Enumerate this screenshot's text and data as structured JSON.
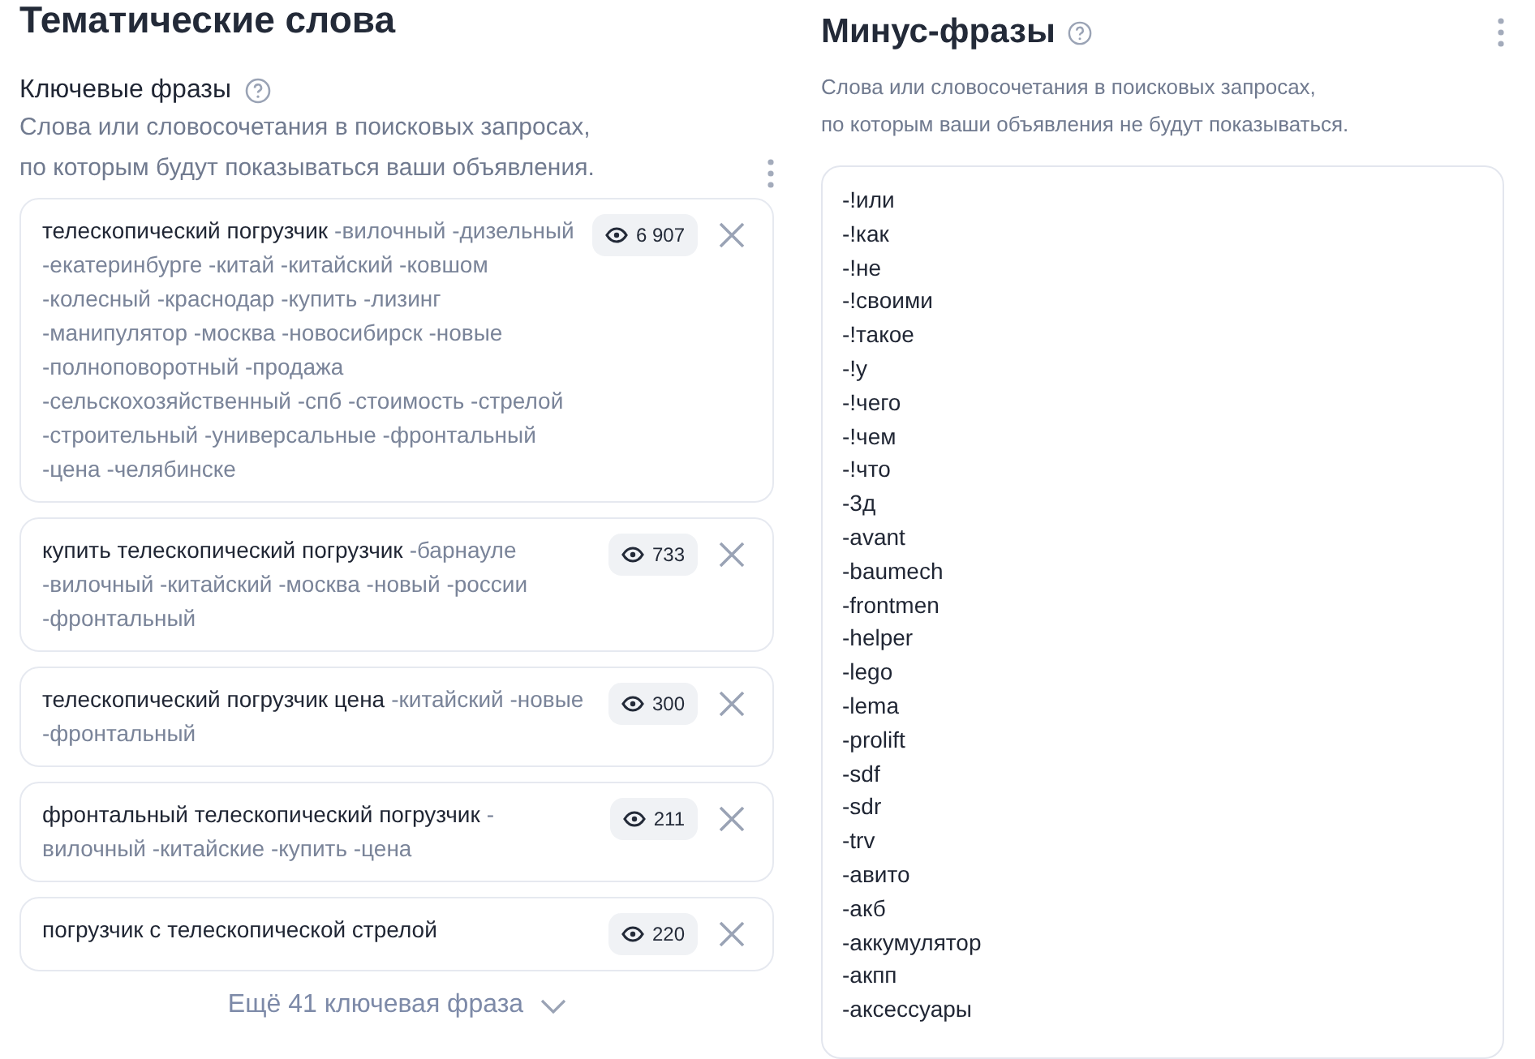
{
  "keywords": {
    "section_title": "Тематические слова",
    "title": "Ключевые фразы",
    "description": [
      "Слова или словосочетания в поисковых запросах,",
      "по которым будут показываться ваши объявления."
    ],
    "phrases": [
      {
        "phrase": "телескопический погрузчик",
        "minus_words": "-вилочный -дизельный -екатеринбурге -китай -китайский -ковшом -колесный -краснодар -купить -лизинг -манипулятор -москва -новосибирск -новые -полноповоротный -продажа -сельскохозяйственный -спб -стоимость -стрелой -строительный -универсальные -фронтальный -цена -челябинске",
        "impressions": "6 907"
      },
      {
        "phrase": "купить телескопический погрузчик",
        "minus_words": "-барнауле -вилочный -китайский -москва -новый -россии -фронтальный",
        "impressions": "733"
      },
      {
        "phrase": "телескопический погрузчик цена",
        "minus_words": "-китайский -новые -фронтальный",
        "impressions": "300"
      },
      {
        "phrase": "фронтальный телескопический погрузчик",
        "minus_words": "-вилочный -китайские -купить -цена",
        "impressions": "211"
      },
      {
        "phrase": "погрузчик с телескопической стрелой",
        "impressions": "220"
      }
    ],
    "more_link": "Ещё 41 ключевая фраза"
  },
  "minus_phrases": {
    "title": "Минус-фразы",
    "description": [
      "Слова или словосочетания в поисковых запросах,",
      "по которым ваши объявления не будут показываться."
    ],
    "lines": [
      "-!или",
      "-!как",
      "-!не",
      "-!своими",
      "-!такое",
      "-!у",
      "-!чего",
      "-!чем",
      "-!что",
      "-3д",
      "-avant",
      "-baumech",
      "-frontmen",
      "-helper",
      "-lego",
      "-lema",
      "-prolift",
      "-sdf",
      "-sdr",
      "-trv",
      "-авито",
      "-акб",
      "-аккумулятор",
      "-акпп",
      "-аксессуары"
    ]
  }
}
